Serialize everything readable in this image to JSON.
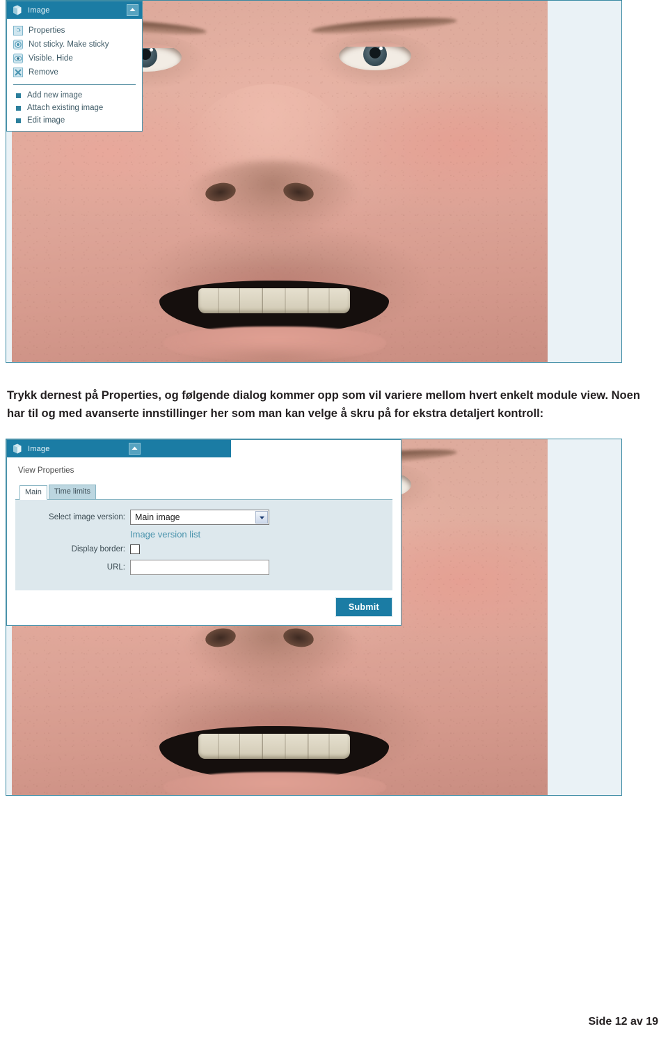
{
  "document": {
    "body_paragraph": "Trykk dernest på Properties, og følgende dialog kommer opp som vil variere mellom hvert enkelt module view. Noen har til og med avanserte innstillinger her som man kan velge å skru på for ekstra detaljert kontroll:",
    "footer": "Side 12 av 19"
  },
  "colors": {
    "titlebar_teal": "#1b7ca4",
    "panel_border": "#4c93ab",
    "menu_text": "#3e5a66",
    "link_teal": "#4a93ac",
    "form_bg": "#dde8ed",
    "tab_inactive": "#bcd6e0",
    "page_bg": "#eaf2f6",
    "submit_bg": "#1b7ca4"
  },
  "screenshot_top": {
    "panel": {
      "titlebar": {
        "title": "Image",
        "cube_icon": "cube-icon",
        "collapse_icon": "collapse-icon"
      },
      "menu_items": [
        {
          "icon": "properties-gear-icon",
          "label": "Properties"
        },
        {
          "icon": "sticky-circle-icon",
          "label": "Not sticky. Make sticky"
        },
        {
          "icon": "visible-eye-icon",
          "label": "Visible. Hide"
        },
        {
          "icon": "remove-x-icon",
          "label": "Remove"
        }
      ],
      "action_items": [
        {
          "bullet": "square-bullet-icon",
          "label": "Add new image"
        },
        {
          "bullet": "square-bullet-icon",
          "label": "Attach existing image"
        },
        {
          "bullet": "square-bullet-icon",
          "label": "Edit image"
        }
      ]
    }
  },
  "screenshot_bottom": {
    "panel": {
      "titlebar": {
        "title": "Image",
        "cube_icon": "cube-icon",
        "collapse_icon": "collapse-icon"
      },
      "dialog": {
        "heading": "View Properties",
        "tabs": [
          {
            "label": "Main",
            "active": true
          },
          {
            "label": "Time limits",
            "active": false
          }
        ],
        "fields": {
          "select_image_version": {
            "label": "Select image version:",
            "value": "Main image",
            "arrow_icon": "chevron-down-icon"
          },
          "image_version_link": "Image version list",
          "display_border": {
            "label": "Display border:",
            "checked": false
          },
          "url": {
            "label": "URL:",
            "value": "",
            "placeholder": ""
          }
        },
        "submit_label": "Submit"
      }
    }
  }
}
